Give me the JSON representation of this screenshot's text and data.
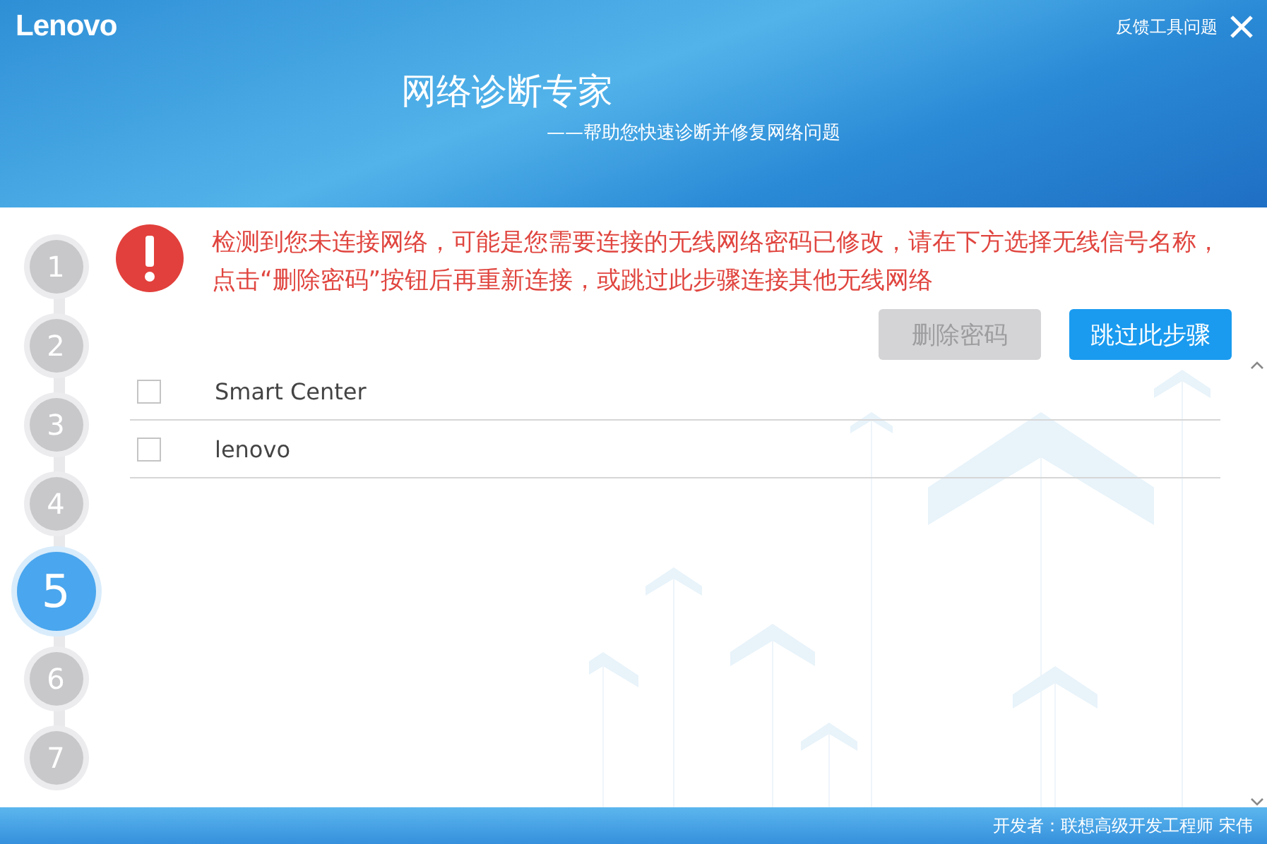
{
  "header": {
    "logo": "Lenovo",
    "feedback_link": "反馈工具问题",
    "title": "网络诊断专家",
    "subtitle": "——帮助您快速诊断并修复网络问题"
  },
  "steps": [
    {
      "label": "1",
      "selected": false
    },
    {
      "label": "2",
      "selected": false
    },
    {
      "label": "3",
      "selected": false
    },
    {
      "label": "4",
      "selected": false
    },
    {
      "label": "5",
      "selected": true
    },
    {
      "label": "6",
      "selected": false
    },
    {
      "label": "7",
      "selected": false
    }
  ],
  "alert": {
    "message": "检测到您未连接网络，可能是您需要连接的无线网络密码已修改，请在下方选择无线信号名称，点击“删除密码”按钮后再重新连接，或跳过此步骤连接其他无线网络"
  },
  "buttons": [
    {
      "label": "删除密码",
      "disabled": true
    },
    {
      "label": "跳过此步骤",
      "disabled": false
    }
  ],
  "networks": [
    {
      "name": "Smart Center",
      "checked": false
    },
    {
      "name": "lenovo",
      "checked": false
    }
  ],
  "status_bar": "开发者：联想高级开发工程师 宋伟"
}
